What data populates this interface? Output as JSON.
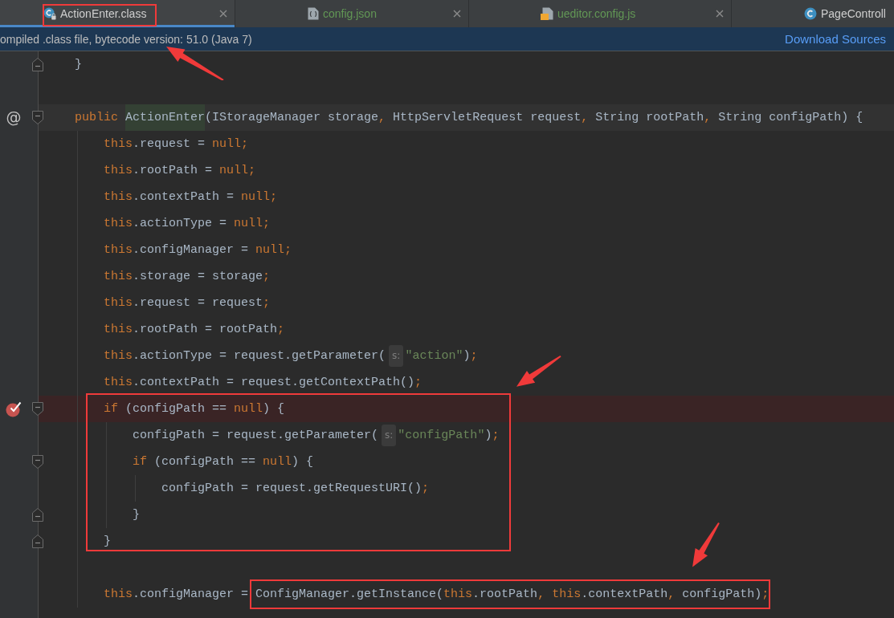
{
  "tabs": [
    {
      "label": "ActionEnter.class",
      "kind": "compiled_class",
      "color": "#cfcfcf",
      "selected": true,
      "close_button": true,
      "boxed": true
    },
    {
      "label": "config.json",
      "kind": "json",
      "color": "#629755",
      "selected": false,
      "close_button": true
    },
    {
      "label": "ueditor.config.js",
      "kind": "javascript",
      "color": "#629755",
      "selected": false,
      "close_button": true
    },
    {
      "label": "PageControll",
      "kind": "class",
      "color": "#cfcfcf",
      "selected": false
    }
  ],
  "banner": {
    "message": "ompiled .class file, bytecode version: 51.0 (Java 7)",
    "link": "Download Sources"
  },
  "lines": [
    {
      "kind": "closing",
      "fold_end": true,
      "tokens": [
        {
          "kind": "plain",
          "text": "}"
        }
      ]
    },
    {
      "kind": "blank"
    },
    {
      "kind": "code",
      "caret": true,
      "gutter_mark": "@",
      "fold_start": true,
      "tokens": [
        {
          "kind": "keyword",
          "text": "public "
        },
        {
          "kind": "declaration",
          "text": "ActionEnter"
        },
        {
          "kind": "plain",
          "text": "(IStorageManager storage"
        },
        {
          "kind": "keyword",
          "text": ","
        },
        {
          "kind": "plain",
          "text": " HttpServletRequest request"
        },
        {
          "kind": "keyword",
          "text": ","
        },
        {
          "kind": "plain",
          "text": " String rootPath"
        },
        {
          "kind": "keyword",
          "text": ","
        },
        {
          "kind": "plain",
          "text": " String configPath) {"
        }
      ],
      "children": [
        {
          "kind": "code",
          "tokens": [
            {
              "kind": "keyword",
              "text": "this"
            },
            {
              "kind": "plain",
              "text": ".request = "
            },
            {
              "kind": "keyword",
              "text": "null;"
            }
          ]
        },
        {
          "kind": "code",
          "tokens": [
            {
              "kind": "keyword",
              "text": "this"
            },
            {
              "kind": "plain",
              "text": ".rootPath = "
            },
            {
              "kind": "keyword",
              "text": "null;"
            }
          ]
        },
        {
          "kind": "code",
          "tokens": [
            {
              "kind": "keyword",
              "text": "this"
            },
            {
              "kind": "plain",
              "text": ".contextPath = "
            },
            {
              "kind": "keyword",
              "text": "null;"
            }
          ]
        },
        {
          "kind": "code",
          "tokens": [
            {
              "kind": "keyword",
              "text": "this"
            },
            {
              "kind": "plain",
              "text": ".actionType = "
            },
            {
              "kind": "keyword",
              "text": "null;"
            }
          ]
        },
        {
          "kind": "code",
          "tokens": [
            {
              "kind": "keyword",
              "text": "this"
            },
            {
              "kind": "plain",
              "text": ".configManager = "
            },
            {
              "kind": "keyword",
              "text": "null;"
            }
          ]
        },
        {
          "kind": "code",
          "tokens": [
            {
              "kind": "keyword",
              "text": "this"
            },
            {
              "kind": "plain",
              "text": ".storage = storage"
            },
            {
              "kind": "keyword",
              "text": ";"
            }
          ]
        },
        {
          "kind": "code",
          "tokens": [
            {
              "kind": "keyword",
              "text": "this"
            },
            {
              "kind": "plain",
              "text": ".request = request"
            },
            {
              "kind": "keyword",
              "text": ";"
            }
          ]
        },
        {
          "kind": "code",
          "tokens": [
            {
              "kind": "keyword",
              "text": "this"
            },
            {
              "kind": "plain",
              "text": ".rootPath = rootPath"
            },
            {
              "kind": "keyword",
              "text": ";"
            }
          ]
        },
        {
          "kind": "code",
          "tokens": [
            {
              "kind": "keyword",
              "text": "this"
            },
            {
              "kind": "plain",
              "text": ".actionType = request.getParameter("
            },
            {
              "kind": "hint",
              "text": "s:"
            },
            {
              "kind": "string",
              "text": "\"action\""
            },
            {
              "kind": "plain",
              "text": ")"
            },
            {
              "kind": "keyword",
              "text": ";"
            }
          ]
        },
        {
          "kind": "code",
          "tokens": [
            {
              "kind": "keyword",
              "text": "this"
            },
            {
              "kind": "plain",
              "text": ".contextPath = request.getContextPath()"
            },
            {
              "kind": "keyword",
              "text": ";"
            }
          ]
        },
        {
          "kind": "code",
          "breakpoint": true,
          "fold_start": true,
          "boxed": true,
          "tokens": [
            {
              "kind": "keyword",
              "text": "if"
            },
            {
              "kind": "plain",
              "text": " (configPath == "
            },
            {
              "kind": "keyword",
              "text": "null"
            },
            {
              "kind": "plain",
              "text": ") {"
            }
          ],
          "children": [
            {
              "kind": "code",
              "tokens": [
                {
                  "kind": "plain",
                  "text": "configPath = request.getParameter("
                },
                {
                  "kind": "hint",
                  "text": "s:"
                },
                {
                  "kind": "string",
                  "text": "\"configPath\""
                },
                {
                  "kind": "plain",
                  "text": ")"
                },
                {
                  "kind": "keyword",
                  "text": ";"
                }
              ]
            },
            {
              "kind": "code",
              "fold_start": true,
              "tokens": [
                {
                  "kind": "keyword",
                  "text": "if"
                },
                {
                  "kind": "plain",
                  "text": " (configPath == "
                },
                {
                  "kind": "keyword",
                  "text": "null"
                },
                {
                  "kind": "plain",
                  "text": ") {"
                }
              ],
              "children": [
                {
                  "kind": "code",
                  "tokens": [
                    {
                      "kind": "plain",
                      "text": "configPath = request.getRequestURI()"
                    },
                    {
                      "kind": "keyword",
                      "text": ";"
                    }
                  ]
                },
                {
                  "kind": "closing",
                  "fold_end": true,
                  "tokens": [
                    {
                      "kind": "plain",
                      "text": "}"
                    }
                  ]
                }
              ]
            },
            {
              "kind": "closing",
              "fold_end": true,
              "tokens": [
                {
                  "kind": "plain",
                  "text": "}"
                }
              ]
            }
          ]
        },
        {
          "kind": "blank"
        },
        {
          "kind": "code",
          "tokens": [
            {
              "kind": "keyword",
              "text": "this"
            },
            {
              "kind": "plain",
              "text": ".configManager = "
            },
            {
              "kind": "group",
              "boxed": true,
              "tokens": [
                {
                  "kind": "plain",
                  "text": "ConfigManager.getInstance("
                },
                {
                  "kind": "keyword",
                  "text": "this"
                },
                {
                  "kind": "plain",
                  "text": ".rootPath"
                },
                {
                  "kind": "keyword",
                  "text": ", "
                },
                {
                  "kind": "keyword",
                  "text": "this"
                },
                {
                  "kind": "plain",
                  "text": ".contextPath"
                },
                {
                  "kind": "keyword",
                  "text": ","
                },
                {
                  "kind": "plain",
                  "text": " configPath)"
                },
                {
                  "kind": "keyword",
                  "text": ";"
                }
              ]
            }
          ]
        }
      ]
    }
  ],
  "annotations": [
    {
      "kind": "arrow"
    },
    {
      "kind": "arrow"
    },
    {
      "kind": "arrow"
    }
  ]
}
